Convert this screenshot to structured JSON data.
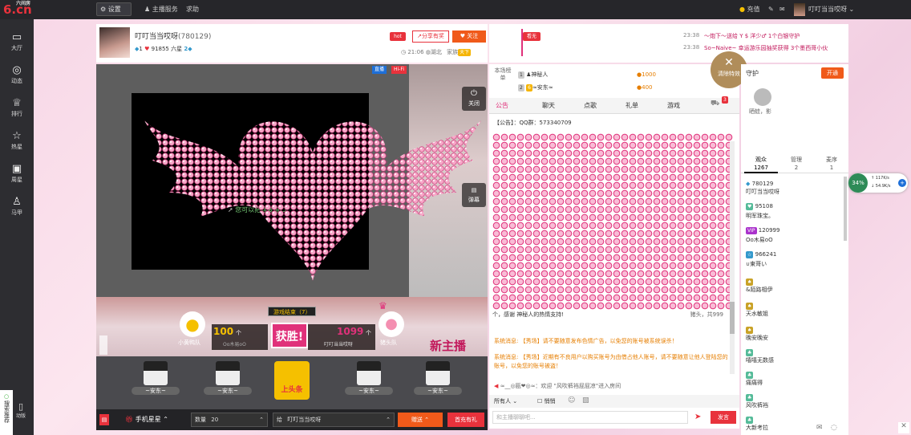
{
  "topbar": {
    "logo": "6.cn",
    "logo_small": "六间房",
    "settings": "设置",
    "host_service": "主播服务",
    "help": "求助",
    "recharge": "充值",
    "username": "叮叮当当哎呀"
  },
  "sidebar": [
    {
      "icon": "tv-icon",
      "label": "大厅"
    },
    {
      "icon": "compass-icon",
      "label": "动态"
    },
    {
      "icon": "crown-icon",
      "label": "排行"
    },
    {
      "icon": "star-icon",
      "label": "热星"
    },
    {
      "icon": "gift-box-icon",
      "label": "周星"
    },
    {
      "icon": "shirt-icon",
      "label": "马甲"
    }
  ],
  "sidebar_bottom": {
    "search_label": "搜索推荐",
    "mobile_label": "动版"
  },
  "host": {
    "name": "叮叮当当哎呀",
    "id": "(780129)",
    "level_num": "1",
    "fans": "91855",
    "fans_suffix": "六星",
    "rank": "2",
    "hot": "hot",
    "share": "分享有奖",
    "follow": "关注",
    "time": "21:06",
    "location": "湖北",
    "family": "家族",
    "family_tag": "天下",
    "banner": "看无"
  },
  "notices": [
    {
      "time": "23:38",
      "text": "～炮下～送给 Y $ 洋少♂ 1个白银守护"
    },
    {
      "time": "23:38",
      "text": "So~Naive~ 幸运游乐园抽奖获得 3个墨西哥小伙"
    }
  ],
  "video": {
    "live": "直播",
    "hifi": "Hi-Fi",
    "close": "关闭",
    "danmaku": "弹幕",
    "screen_text": "您可以把连麦窗口",
    "game_over": "游戏结束（7）",
    "new_anchor": "新主播",
    "team_left_score": "100",
    "team_left_unit": "个",
    "team_left_name": "小黄鸭队",
    "team_left_user": "Oo木易oO",
    "win": "获胜!",
    "team_right_score": "1099",
    "team_right_unit": "个",
    "team_right_user": "叮叮当当哎呀",
    "team_right_name": "猪头队"
  },
  "gift_row": {
    "names": [
      "~安东~",
      "~安东~",
      "上头条",
      "~安东~",
      "~安东~"
    ]
  },
  "gift_bar": {
    "phone_star": "手机星星",
    "qty_label": "数量",
    "qty": "20",
    "to_label": "给",
    "to_user": "叮叮当当哎呀",
    "send": "赠送",
    "recharge": "首充有礼"
  },
  "rank": {
    "title": "本场榜单",
    "rows": [
      {
        "num": "1",
        "name": "神秘人",
        "coins": "1000"
      },
      {
        "num": "2",
        "name": "≈安东≈",
        "coins": "400"
      }
    ],
    "clear_effects": "清除特效"
  },
  "chat_tabs": [
    "聊天",
    "点歌",
    "礼单",
    "游戏"
  ],
  "chat_tab_active": "公告",
  "chat_tab_badge": "3",
  "chat": {
    "notice": "【公告】：QQ群：573340709",
    "thank": "个，感谢 神秘人的热情支持!",
    "pig": "猪头，共999",
    "sys1": "系统消息: 【秀场】请不要随意发布色情广告，以免您的账号被系统误杀！",
    "sys2": "系统消息: 【秀场】近期有不良用户以购买账号为由借占他人账号，请不要随意让他人登陆您的账号，以免您的账号被盗！",
    "enter": "≈__◎瓯❤◎≈：欢迎 \"风吹裤裆屁屁凉\"进入房间",
    "to_all": "所有人",
    "private": "悄悄",
    "placeholder": "和主播聊聊吧...",
    "send": "发言"
  },
  "guard": {
    "title": "守护",
    "open": "开通",
    "member": "晒蛙，影"
  },
  "viewers": {
    "tabs": [
      {
        "label": "观众",
        "count": "1267"
      },
      {
        "label": "管理",
        "count": "2"
      },
      {
        "label": "麦序",
        "count": "1"
      }
    ],
    "list": [
      {
        "id": "780129",
        "name": "叮叮当当哎呀"
      },
      {
        "id": "95108",
        "name": "明军珠宝。"
      },
      {
        "id": "120999",
        "name": "Oo木易oO"
      },
      {
        "id": "966241",
        "name": "∪東哥い"
      },
      {
        "id": "",
        "name": "&陌路相伊"
      },
      {
        "id": "",
        "name": "天水敏姐"
      },
      {
        "id": "",
        "name": "晚安晚安"
      },
      {
        "id": "",
        "name": "嘻嘻无数感"
      },
      {
        "id": "",
        "name": "痛痛得"
      },
      {
        "id": "",
        "name": "风吹裤裆"
      },
      {
        "id": "",
        "name": "大新考拉"
      }
    ]
  },
  "speed": {
    "percent": "34%",
    "up": "117K/s",
    "down": "54.9K/s"
  },
  "colors": {
    "accent": "#e8323c",
    "orange": "#f05a1a",
    "pink": "#e0317a"
  }
}
